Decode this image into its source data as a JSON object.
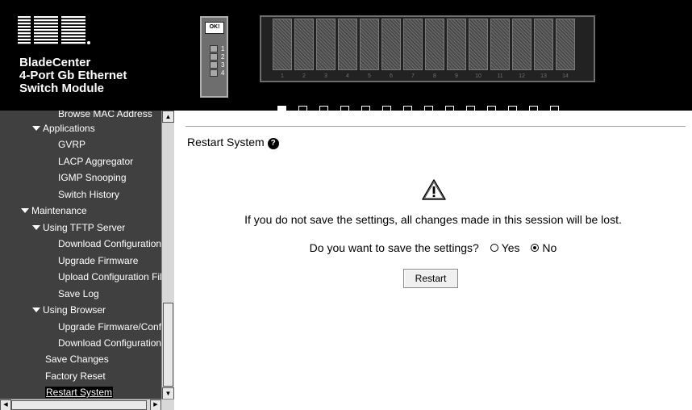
{
  "header": {
    "logo": "IBM",
    "product_title": [
      "BladeCenter",
      "4-Port Gb Ethernet",
      "Switch Module"
    ],
    "module": {
      "ok_label": "OK!",
      "ports": [
        "1",
        "2",
        "3",
        "4"
      ]
    },
    "chassis": {
      "slots": [
        "1",
        "2",
        "3",
        "4",
        "5",
        "6",
        "7",
        "8",
        "9",
        "10",
        "11",
        "12",
        "13",
        "14"
      ],
      "selected_slot": "1"
    }
  },
  "sidebar": {
    "items": [
      {
        "label": "Browse MAC Address",
        "level": 3,
        "expander": false
      },
      {
        "label": "Applications",
        "level": 2,
        "expander": true
      },
      {
        "label": "GVRP",
        "level": 3,
        "expander": false
      },
      {
        "label": "LACP Aggregator",
        "level": 3,
        "expander": false
      },
      {
        "label": "IGMP Snooping",
        "level": 3,
        "expander": false
      },
      {
        "label": "Switch History",
        "level": 3,
        "expander": false
      },
      {
        "label": "Maintenance",
        "level": 1,
        "expander": true
      },
      {
        "label": "Using TFTP Server",
        "level": 2,
        "expander": true
      },
      {
        "label": "Download Configuration",
        "level": 3,
        "expander": false
      },
      {
        "label": "Upgrade Firmware",
        "level": 3,
        "expander": false
      },
      {
        "label": "Upload Configuration Fil",
        "level": 3,
        "expander": false
      },
      {
        "label": "Save Log",
        "level": 3,
        "expander": false
      },
      {
        "label": "Using Browser",
        "level": 2,
        "expander": true
      },
      {
        "label": "Upgrade Firmware/Conf",
        "level": 3,
        "expander": false
      },
      {
        "label": "Download Configuration",
        "level": 3,
        "expander": false
      },
      {
        "label": "Save Changes",
        "level": 2,
        "expander": false
      },
      {
        "label": "Factory Reset",
        "level": 2,
        "expander": false
      },
      {
        "label": "Restart System",
        "level": 2,
        "expander": false,
        "active": true
      }
    ]
  },
  "content": {
    "title": "Restart System",
    "help_icon": "question-icon",
    "warning_icon": "warning-icon",
    "warning_text": "If you do not save the settings, all changes made in this session will be lost.",
    "save_prompt": "Do you want to save the settings?",
    "options": [
      {
        "label": "Yes",
        "checked": false
      },
      {
        "label": "No",
        "checked": true
      }
    ],
    "restart_label": "Restart"
  },
  "colors": {
    "header_bg": "#000000",
    "sidebar_bg": "#404040",
    "content_bg": "#ffffff"
  }
}
